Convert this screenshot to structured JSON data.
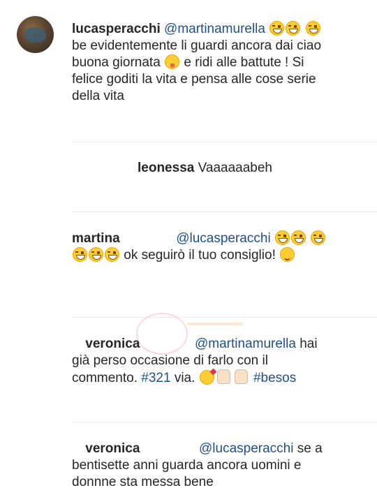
{
  "comments": [
    {
      "user": "lucasperacchi",
      "mention": "@martinamurella",
      "text1": "be evidentemente li guardi ancora dai ciao buona giornata",
      "text2": "e ridi alle battute ! Si felice goditi la vita e pensa alle cose serie della vita"
    },
    {
      "user": "leonessa",
      "text": "Vaaaaaabeh"
    },
    {
      "user": "martina",
      "mention": "@lucasperacchi",
      "text": "ok seguirò il tuo consiglio!"
    },
    {
      "user": "veronica",
      "mention": "@martinamurella",
      "text": "hai già perso occasione di farlo con il commento.",
      "hashtag1": "#321",
      "text2": "via.",
      "hashtag2": "#besos"
    },
    {
      "user": "veronica",
      "mention": "@lucasperacchi",
      "text": "se a bentisette anni guarda ancora uomini e donnne sta messa bene"
    }
  ],
  "icons": [
    "laugh-emoji",
    "tongue-emoji",
    "wink-emoji",
    "kiss-emoji",
    "fist-emoji"
  ]
}
